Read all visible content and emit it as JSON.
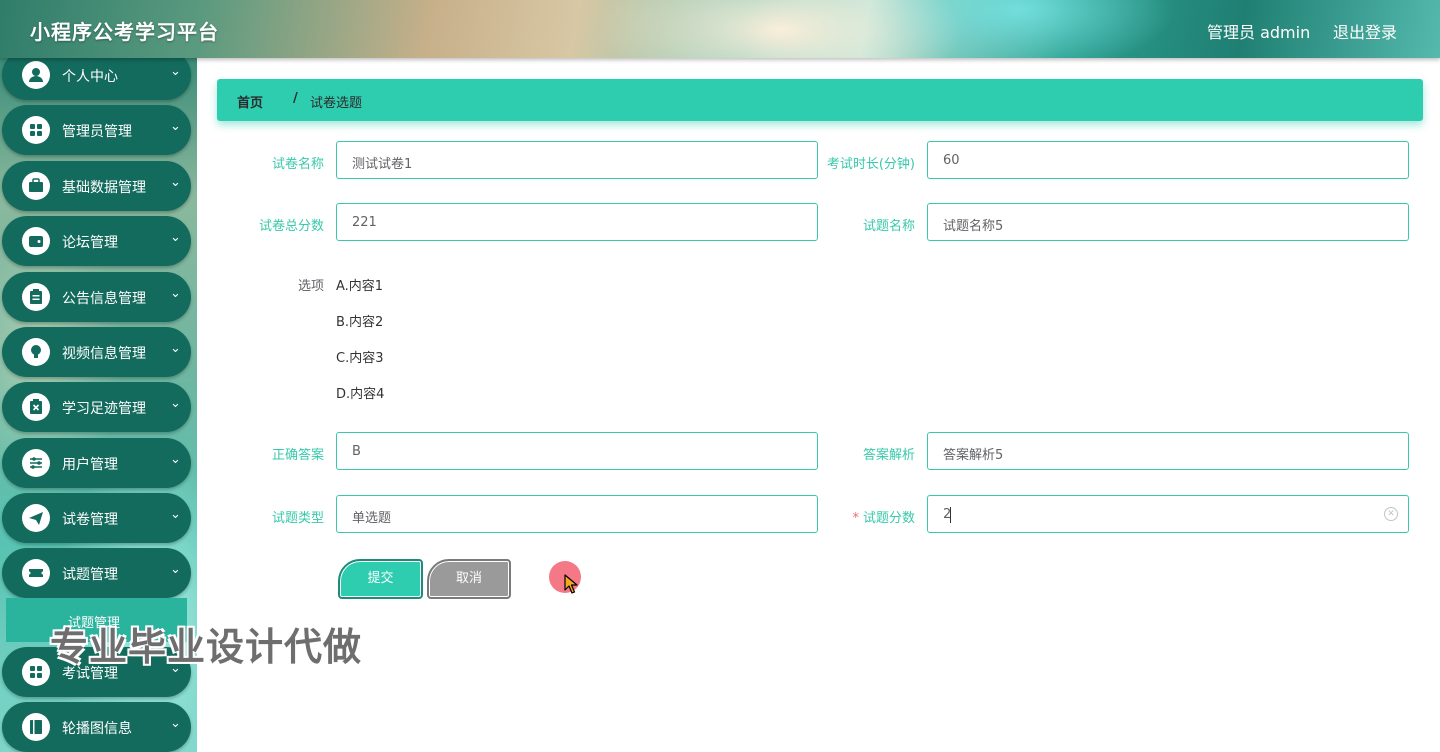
{
  "header": {
    "brand": "小程序公考学习平台",
    "user": "管理员 admin",
    "logout": "退出登录"
  },
  "sidebar": {
    "items": [
      {
        "label": "个人中心",
        "icon": "user-icon"
      },
      {
        "label": "管理员管理",
        "icon": "grid-icon"
      },
      {
        "label": "基础数据管理",
        "icon": "briefcase-icon"
      },
      {
        "label": "论坛管理",
        "icon": "wallet-icon"
      },
      {
        "label": "公告信息管理",
        "icon": "clipboard-icon"
      },
      {
        "label": "视频信息管理",
        "icon": "lightbulb-icon"
      },
      {
        "label": "学习足迹管理",
        "icon": "clipboard-x-icon"
      },
      {
        "label": "用户管理",
        "icon": "sliders-icon"
      },
      {
        "label": "试卷管理",
        "icon": "send-icon"
      },
      {
        "label": "试题管理",
        "icon": "ticket-icon"
      },
      {
        "label": "考试管理",
        "icon": "grid-icon"
      },
      {
        "label": "轮播图信息",
        "icon": "book-icon"
      }
    ],
    "submenu_active": "试题管理"
  },
  "breadcrumb": {
    "home": "首页",
    "separator": "/",
    "current": "试卷选题"
  },
  "form": {
    "paper_name": {
      "label": "试卷名称",
      "value": "测试试卷1"
    },
    "exam_duration": {
      "label": "考试时长(分钟)",
      "value": "60"
    },
    "total_score": {
      "label": "试卷总分数",
      "value": "221"
    },
    "question_name": {
      "label": "试题名称",
      "value": "试题名称5"
    },
    "options": {
      "label": "选项",
      "items": [
        "A.内容1",
        "B.内容2",
        "C.内容3",
        "D.内容4"
      ]
    },
    "correct_answer": {
      "label": "正确答案",
      "value": "B"
    },
    "answer_analysis": {
      "label": "答案解析",
      "value": "答案解析5"
    },
    "question_type": {
      "label": "试题类型",
      "value": "单选题"
    },
    "question_score": {
      "label": "试题分数",
      "value": "2",
      "required_mark": "*"
    }
  },
  "buttons": {
    "submit": "提交",
    "cancel": "取消"
  },
  "watermark": "专业毕业设计代做",
  "colors": {
    "accent": "#2fcdb0",
    "label": "#38c9ab",
    "sidebar_item": "#136b5d",
    "cancel": "#9a9a9a",
    "required": "#f56c6c"
  }
}
